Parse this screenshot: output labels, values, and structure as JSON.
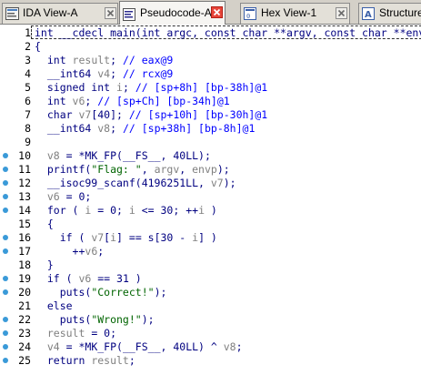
{
  "tabs": [
    {
      "label": "IDA View-A",
      "icon": "ida-view-icon",
      "active": false
    },
    {
      "label": "Pseudocode-A",
      "icon": "pseudocode-icon",
      "active": true
    },
    {
      "label": "Hex View-1",
      "icon": "hex-view-icon",
      "active": false
    },
    {
      "label": "Structures",
      "icon": "structures-icon",
      "active": false
    }
  ],
  "colors": {
    "keyword": "#000080",
    "variable_gray": "#808080",
    "comment": "#0000ff",
    "string": "#006400",
    "breakpoint_dot": "#3a9ad8",
    "active_close": "#e7453a"
  },
  "code_lines": [
    {
      "n": "1",
      "dot": false,
      "segs": [
        [
          "kw",
          "int __cdecl main(int argc, const char **argv, const char **envp)"
        ]
      ]
    },
    {
      "n": "2",
      "dot": false,
      "segs": [
        [
          "kw",
          "{"
        ]
      ]
    },
    {
      "n": "3",
      "dot": false,
      "segs": [
        [
          "kw",
          "  int "
        ],
        [
          "gray",
          "result"
        ],
        [
          "kw",
          "; "
        ],
        [
          "cmt",
          "// eax@9"
        ]
      ]
    },
    {
      "n": "4",
      "dot": false,
      "segs": [
        [
          "kw",
          "  __int64 "
        ],
        [
          "gray",
          "v4"
        ],
        [
          "kw",
          "; "
        ],
        [
          "cmt",
          "// rcx@9"
        ]
      ]
    },
    {
      "n": "5",
      "dot": false,
      "segs": [
        [
          "kw",
          "  signed int "
        ],
        [
          "gray",
          "i"
        ],
        [
          "kw",
          "; "
        ],
        [
          "cmt",
          "// [sp+8h] [bp-38h]@1"
        ]
      ]
    },
    {
      "n": "6",
      "dot": false,
      "segs": [
        [
          "kw",
          "  int "
        ],
        [
          "gray",
          "v6"
        ],
        [
          "kw",
          "; "
        ],
        [
          "cmt",
          "// [sp+Ch] [bp-34h]@1"
        ]
      ]
    },
    {
      "n": "7",
      "dot": false,
      "segs": [
        [
          "kw",
          "  char "
        ],
        [
          "gray",
          "v7"
        ],
        [
          "kw",
          "[40]; "
        ],
        [
          "cmt",
          "// [sp+10h] [bp-30h]@1"
        ]
      ]
    },
    {
      "n": "8",
      "dot": false,
      "segs": [
        [
          "kw",
          "  __int64 "
        ],
        [
          "gray",
          "v8"
        ],
        [
          "kw",
          "; "
        ],
        [
          "cmt",
          "// [sp+38h] [bp-8h]@1"
        ]
      ]
    },
    {
      "n": "9",
      "dot": false,
      "segs": [
        [
          "kw",
          ""
        ]
      ]
    },
    {
      "n": "10",
      "dot": true,
      "segs": [
        [
          "kw",
          "  "
        ],
        [
          "gray",
          "v8"
        ],
        [
          "kw",
          " = *MK_FP(__FS__, 40LL);"
        ]
      ]
    },
    {
      "n": "11",
      "dot": true,
      "segs": [
        [
          "kw",
          "  printf("
        ],
        [
          "str",
          "\"Flag: \""
        ],
        [
          "kw",
          ", "
        ],
        [
          "gray",
          "argv"
        ],
        [
          "kw",
          ", "
        ],
        [
          "gray",
          "envp"
        ],
        [
          "kw",
          ");"
        ]
      ]
    },
    {
      "n": "12",
      "dot": true,
      "segs": [
        [
          "kw",
          "  __isoc99_scanf(4196251LL, "
        ],
        [
          "gray",
          "v7"
        ],
        [
          "kw",
          ");"
        ]
      ]
    },
    {
      "n": "13",
      "dot": true,
      "segs": [
        [
          "kw",
          "  "
        ],
        [
          "gray",
          "v6"
        ],
        [
          "kw",
          " = 0;"
        ]
      ]
    },
    {
      "n": "14",
      "dot": true,
      "segs": [
        [
          "kw",
          "  for ( "
        ],
        [
          "gray",
          "i"
        ],
        [
          "kw",
          " = 0; "
        ],
        [
          "gray",
          "i"
        ],
        [
          "kw",
          " <= 30; ++"
        ],
        [
          "gray",
          "i"
        ],
        [
          "kw",
          " )"
        ]
      ]
    },
    {
      "n": "15",
      "dot": false,
      "segs": [
        [
          "kw",
          "  {"
        ]
      ]
    },
    {
      "n": "16",
      "dot": true,
      "segs": [
        [
          "kw",
          "    if ( "
        ],
        [
          "gray",
          "v7"
        ],
        [
          "kw",
          "["
        ],
        [
          "gray",
          "i"
        ],
        [
          "kw",
          "] == s[30 - "
        ],
        [
          "gray",
          "i"
        ],
        [
          "kw",
          "] )"
        ]
      ]
    },
    {
      "n": "17",
      "dot": true,
      "segs": [
        [
          "kw",
          "      ++"
        ],
        [
          "gray",
          "v6"
        ],
        [
          "kw",
          ";"
        ]
      ]
    },
    {
      "n": "18",
      "dot": false,
      "segs": [
        [
          "kw",
          "  }"
        ]
      ]
    },
    {
      "n": "19",
      "dot": true,
      "segs": [
        [
          "kw",
          "  if ( "
        ],
        [
          "gray",
          "v6"
        ],
        [
          "kw",
          " == 31 )"
        ]
      ]
    },
    {
      "n": "20",
      "dot": true,
      "segs": [
        [
          "kw",
          "    puts("
        ],
        [
          "str",
          "\"Correct!\""
        ],
        [
          "kw",
          ");"
        ]
      ]
    },
    {
      "n": "21",
      "dot": false,
      "segs": [
        [
          "kw",
          "  else"
        ]
      ]
    },
    {
      "n": "22",
      "dot": true,
      "segs": [
        [
          "kw",
          "    puts("
        ],
        [
          "str",
          "\"Wrong!\""
        ],
        [
          "kw",
          ");"
        ]
      ]
    },
    {
      "n": "23",
      "dot": true,
      "segs": [
        [
          "kw",
          "  "
        ],
        [
          "gray",
          "result"
        ],
        [
          "kw",
          " = 0;"
        ]
      ]
    },
    {
      "n": "24",
      "dot": true,
      "segs": [
        [
          "kw",
          "  "
        ],
        [
          "gray",
          "v4"
        ],
        [
          "kw",
          " = *MK_FP(__FS__, 40LL) ^ "
        ],
        [
          "gray",
          "v8"
        ],
        [
          "kw",
          ";"
        ]
      ]
    },
    {
      "n": "25",
      "dot": true,
      "segs": [
        [
          "kw",
          "  return "
        ],
        [
          "gray",
          "result"
        ],
        [
          "kw",
          ";"
        ]
      ]
    }
  ]
}
